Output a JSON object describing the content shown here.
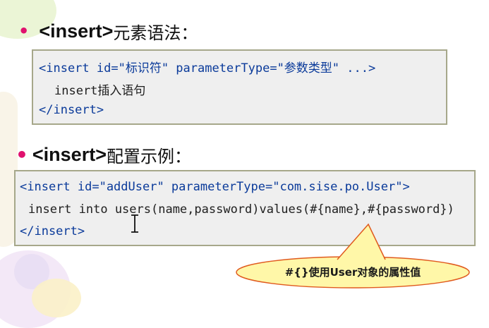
{
  "section1": {
    "bullet": "•",
    "tag": "<insert>",
    "title": "元素语法：",
    "code": {
      "line1": "<insert id=\"标识符\" parameterType=\"参数类型\" ...>",
      "line2": "insert插入语句",
      "line3": "</insert>"
    }
  },
  "section2": {
    "bullet": "•",
    "tag": "<insert>",
    "title": "配置示例：",
    "code": {
      "line1": "<insert id=\"addUser\" parameterType=\"com.sise.po.User\">",
      "line2": "insert into users(name,password)values(#{name},#{password})",
      "line3": "</insert>"
    }
  },
  "callout": {
    "text": "#{}使用User对象的属性值",
    "fill": "#fff7a8",
    "border": "#e05a1e"
  },
  "colors": {
    "bullet": "#e0116e",
    "code_bg": "#efefef",
    "code_border": "#a6a78a",
    "code_tag": "#0a3a9a"
  }
}
